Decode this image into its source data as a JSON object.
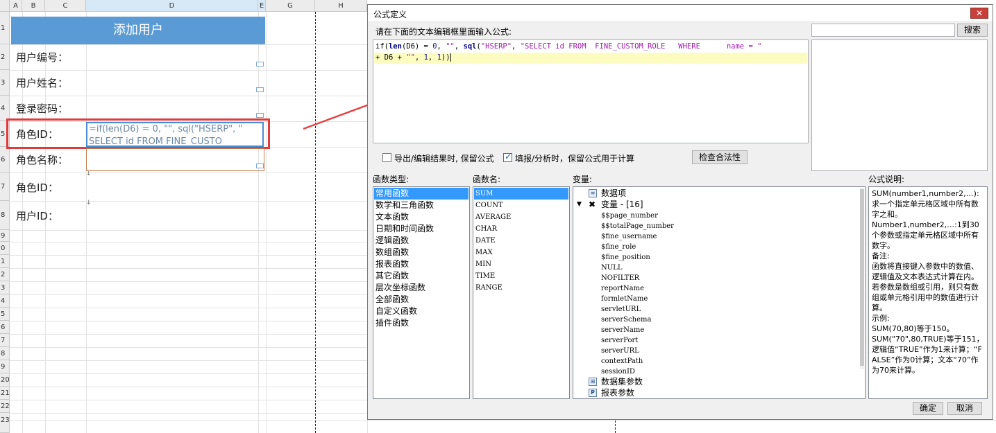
{
  "sheet": {
    "columns": [
      "A",
      "B",
      "C",
      "D",
      "E",
      "G",
      "H"
    ],
    "rows": [
      "1",
      "2",
      "3",
      "4",
      "5",
      "6",
      "7",
      "8",
      "9",
      "0",
      "1",
      "2",
      "3",
      "4",
      "5",
      "6",
      "7",
      "8",
      "9",
      "20",
      "21",
      "22",
      "23"
    ],
    "title": "添加用户",
    "labels": [
      "用户编号：",
      "用户姓名：",
      "登录密码：",
      "角色ID：",
      "角色名称：",
      "角色ID：",
      "用户ID："
    ],
    "formula_cell_lines": [
      "=if(len(D6) = 0, \"\", sql(\"HSERP\", \"",
      "SELECT id FROM  FINE_CUSTO"
    ],
    "accent": "#5b9bd5",
    "highlight_color": "#e03a3a"
  },
  "dialog": {
    "title": "公式定义",
    "close_icon": "close-icon",
    "instruction": "请在下面的文本编辑框里面输入公式:",
    "search_button": "搜索",
    "search_placeholder": "",
    "formula_line1": {
      "t1": "if(",
      "t2": "len",
      "t3": "(D6) = ",
      "t4": "0",
      "t5": ", ",
      "t6": "\"\"",
      "t7": ", ",
      "t8": "sql",
      "t9": "(",
      "t10": "\"HSERP\"",
      "t11": ", ",
      "t12": "\"SELECT id FROM  FINE_CUSTOM_ROLE   WHERE      name = \""
    },
    "formula_line2": {
      "t1": "+ D6 + ",
      "t2": "\"\"",
      "t3": ", ",
      "t4": "1",
      "t5": ", ",
      "t6": "1",
      "t7": "))"
    },
    "checkbox_keep_formula": "导出/编辑结果时, 保留公式",
    "checkbox_keep_calc": "填报/分析时，保留公式用于计算",
    "check_button": "检查合法性",
    "func_type_label": "函数类型:",
    "func_name_label": "函数名:",
    "var_label": "变量:",
    "desc_label": "公式说明:",
    "func_types": [
      "常用函数",
      "数学和三角函数",
      "文本函数",
      "日期和时间函数",
      "逻辑函数",
      "数组函数",
      "报表函数",
      "其它函数",
      "层次坐标函数",
      "全部函数",
      "自定义函数",
      "插件函数"
    ],
    "func_names": [
      "SUM",
      "COUNT",
      "AVERAGE",
      "CHAR",
      "DATE",
      "MAX",
      "MIN",
      "TIME",
      "RANGE"
    ],
    "variables": {
      "data_item": "数据项",
      "var_group": "变量 - [16]",
      "items": [
        "$$page_number",
        "$$totalPage_number",
        "$fine_username",
        "$fine_role",
        "$fine_position",
        "NULL",
        "NOFILTER",
        "reportName",
        "formletName",
        "servletURL",
        "serverSchema",
        "serverName",
        "serverPort",
        "serverURL",
        "contextPath",
        "sessionID"
      ],
      "dataset_params": "数据集参数",
      "report_params": "报表参数"
    },
    "description": [
      "SUM(number1,number2,…):求一个指定单元格区域中所有数字之和。",
      "Number1,number2,…:1到30个参数或指定单元格区域中所有数字。",
      "备注:",
      "函数将直接键入参数中的数值、逻辑值及文本表达式计算在内。若参数是数组或引用，则只有数组或单元格引用中的数值进行计算。",
      "示例:",
      "SUM(70,80)等于150。",
      "SUM(\"70\",80,TRUE)等于151，逻辑值“TRUE”作为1来计算；“FALSE”作为0计算；文本“70”作为70来计算。"
    ],
    "ok_button": "确定",
    "cancel_button": "取消"
  }
}
